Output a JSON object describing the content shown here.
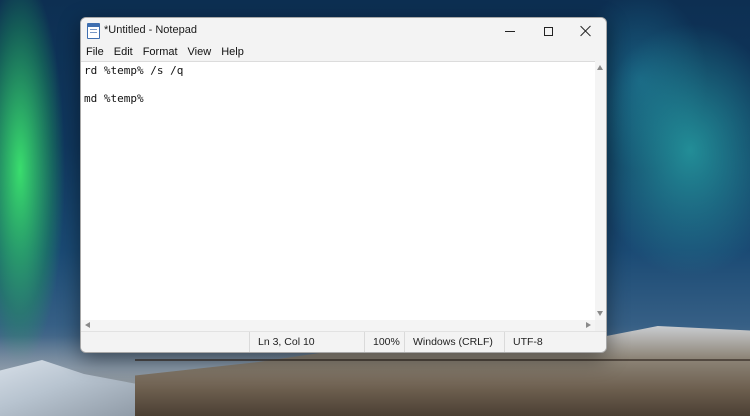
{
  "window": {
    "title": "*Untitled - Notepad"
  },
  "menu": [
    "File",
    "Edit",
    "Format",
    "View",
    "Help"
  ],
  "editor": {
    "lines": [
      "rd %temp% /s /q",
      "",
      "md %temp%"
    ]
  },
  "status": {
    "position": "Ln 3, Col 10",
    "zoom": "100%",
    "line_ending": "Windows (CRLF)",
    "encoding": "UTF-8"
  },
  "icons": {
    "app": "notepad-icon",
    "minimize": "minimize-icon",
    "maximize": "maximize-icon",
    "close": "close-icon"
  },
  "colors": {
    "window_bg": "#f3f3f3",
    "editor_bg": "#ffffff",
    "text": "#111111"
  }
}
